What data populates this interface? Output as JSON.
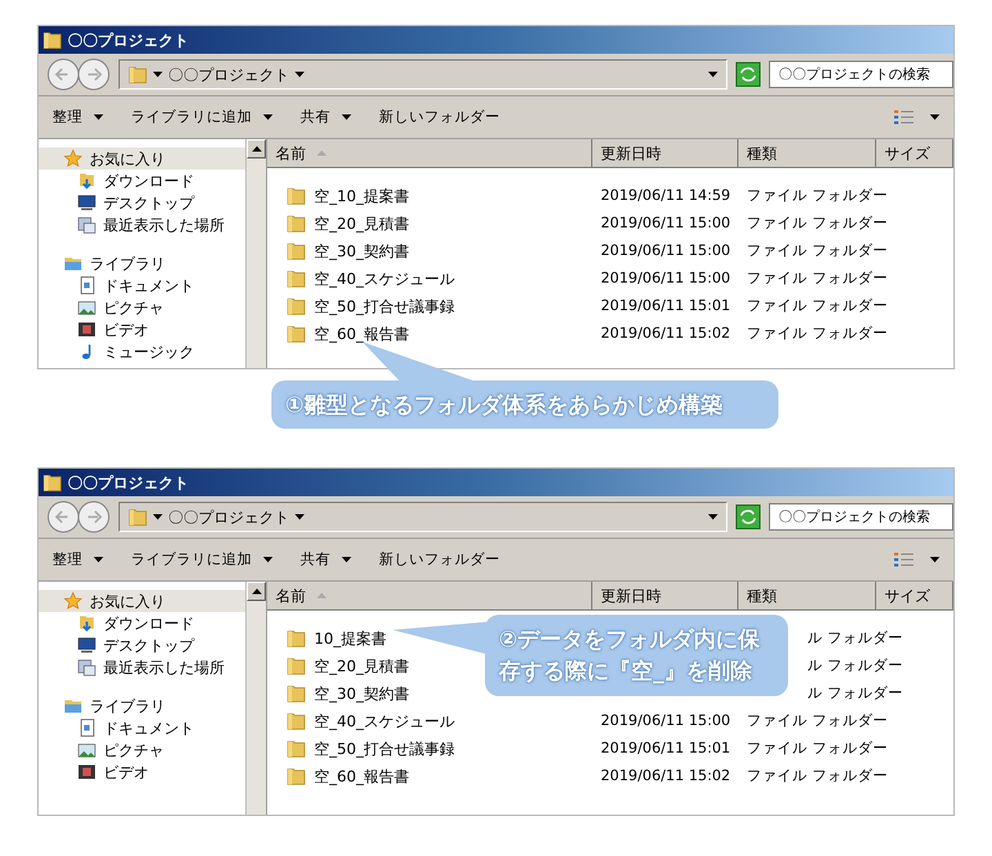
{
  "panels": [
    {
      "window": {
        "title": "〇〇プロジェクト"
      },
      "breadcrumb": "〇〇プロジェクト",
      "search": {
        "placeholder": "〇〇プロジェクトの検索"
      },
      "toolbar": [
        {
          "label": "整理",
          "dropdown": true
        },
        {
          "label": "ライブラリに追加",
          "dropdown": true
        },
        {
          "label": "共有",
          "dropdown": true
        },
        {
          "label": "新しいフォルダー",
          "dropdown": false
        }
      ],
      "sidebar": [
        {
          "label": "お気に入り",
          "selected": true,
          "children": [
            {
              "label": "ダウンロード",
              "selected": false
            },
            {
              "label": "デスクトップ",
              "selected": false
            },
            {
              "label": "最近表示した場所",
              "selected": false
            }
          ]
        },
        {
          "label": "ライブラリ",
          "selected": false,
          "children": [
            {
              "label": "ドキュメント",
              "selected": false
            },
            {
              "label": "ピクチャ",
              "selected": false
            },
            {
              "label": "ビデオ",
              "selected": false
            },
            {
              "label": "ミュージック",
              "selected": false
            }
          ]
        }
      ],
      "columns": [
        "名前",
        "更新日時",
        "種類",
        "サイズ"
      ],
      "rows": [
        {
          "name": "空_10_提案書",
          "modified": "2019/06/11 14:59",
          "type": "ファイル フォルダー"
        },
        {
          "name": "空_20_見積書",
          "modified": "2019/06/11 15:00",
          "type": "ファイル フォルダー"
        },
        {
          "name": "空_30_契約書",
          "modified": "2019/06/11 15:00",
          "type": "ファイル フォルダー"
        },
        {
          "name": "空_40_スケジュール",
          "modified": "2019/06/11 15:00",
          "type": "ファイル フォルダー"
        },
        {
          "name": "空_50_打合せ議事録",
          "modified": "2019/06/11 15:01",
          "type": "ファイル フォルダー"
        },
        {
          "name": "空_60_報告書",
          "modified": "2019/06/11 15:02",
          "type": "ファイル フォルダー"
        }
      ],
      "callout": {
        "kind": "below",
        "text": "①雛型となるフォルダ体系をあらかじめ構築"
      }
    },
    {
      "window": {
        "title": "〇〇プロジェクト"
      },
      "breadcrumb": "〇〇プロジェクト",
      "search": {
        "placeholder": "〇〇プロジェクトの検索"
      },
      "toolbar": [
        {
          "label": "整理",
          "dropdown": true
        },
        {
          "label": "ライブラリに追加",
          "dropdown": true
        },
        {
          "label": "共有",
          "dropdown": true
        },
        {
          "label": "新しいフォルダー",
          "dropdown": false
        }
      ],
      "sidebar": [
        {
          "label": "お気に入り",
          "selected": true,
          "children": [
            {
              "label": "ダウンロード",
              "selected": false
            },
            {
              "label": "デスクトップ",
              "selected": false
            },
            {
              "label": "最近表示した場所",
              "selected": false
            }
          ]
        },
        {
          "label": "ライブラリ",
          "selected": false,
          "children": [
            {
              "label": "ドキュメント",
              "selected": false
            },
            {
              "label": "ピクチャ",
              "selected": false
            },
            {
              "label": "ビデオ",
              "selected": false
            }
          ]
        }
      ],
      "columns": [
        "名前",
        "更新日時",
        "種類",
        "サイズ"
      ],
      "rows": [
        {
          "name": "10_提案書",
          "type": "ル フォルダー"
        },
        {
          "name": "空_20_見積書",
          "type": "ル フォルダー"
        },
        {
          "name": "空_30_契約書",
          "type": "ル フォルダー"
        },
        {
          "name": "空_40_スケジュール",
          "modified": "2019/06/11 15:00",
          "type": "ファイル フォルダー"
        },
        {
          "name": "空_50_打合せ議事録",
          "modified": "2019/06/11 15:01",
          "type": "ファイル フォルダー"
        },
        {
          "name": "空_60_報告書",
          "modified": "2019/06/11 15:02",
          "type": "ファイル フォルダー"
        }
      ],
      "callout": {
        "kind": "overlay",
        "text": "②データをフォルダ内に保存する際に『空_』を削除"
      }
    }
  ]
}
